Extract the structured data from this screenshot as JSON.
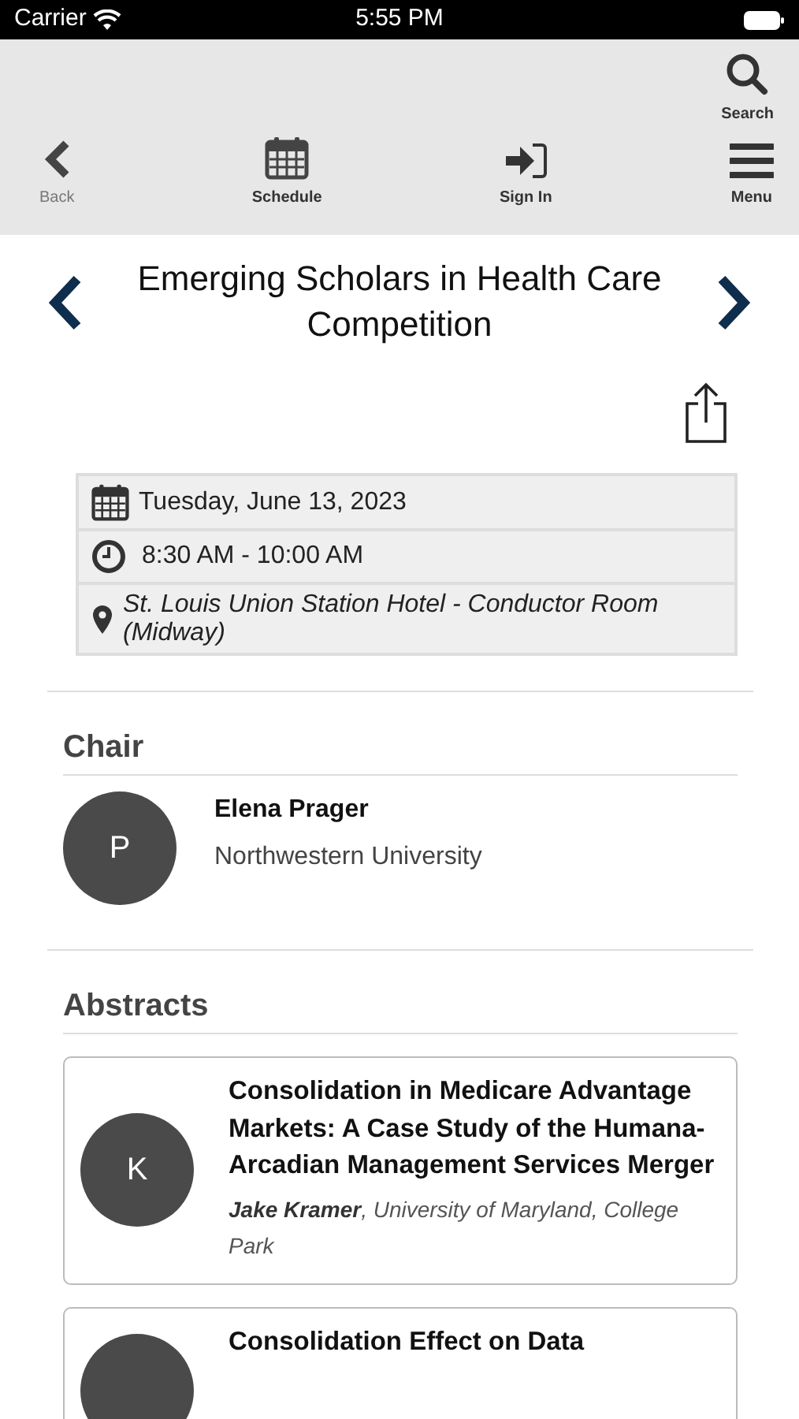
{
  "status_bar": {
    "carrier": "Carrier",
    "time": "5:55 PM"
  },
  "toolbar": {
    "top": [
      {
        "kind": "search",
        "label": "Search"
      }
    ],
    "bottom": [
      {
        "kind": "back",
        "label": "Back"
      },
      {
        "kind": "schedule",
        "label": "Schedule"
      },
      {
        "kind": "signin",
        "label": "Sign In"
      },
      {
        "kind": "menu",
        "label": "Menu"
      }
    ]
  },
  "session": {
    "title": "Emerging Scholars in Health Care Competition",
    "details": [
      {
        "kind": "date",
        "text": "Tuesday, June 13, 2023"
      },
      {
        "kind": "time",
        "text": "8:30 AM - 10:00 AM"
      },
      {
        "kind": "location",
        "text": "St. Louis Union Station Hotel - Conductor Room (Midway)"
      }
    ]
  },
  "chair": {
    "heading": "Chair",
    "people": [
      {
        "initial": "P",
        "name": "Elena Prager",
        "affiliation": "Northwestern University"
      }
    ]
  },
  "abstracts": {
    "heading": "Abstracts",
    "items": [
      {
        "initial": "K",
        "title": "Consolidation in Medicare Advantage Markets: A Case Study of the Humana-Arcadian Management Services Merger",
        "authors": "**Jake Kramer**, University of Maryland, College Park"
      },
      {
        "title": "Consolidation Effect on Data"
      }
    ]
  }
}
